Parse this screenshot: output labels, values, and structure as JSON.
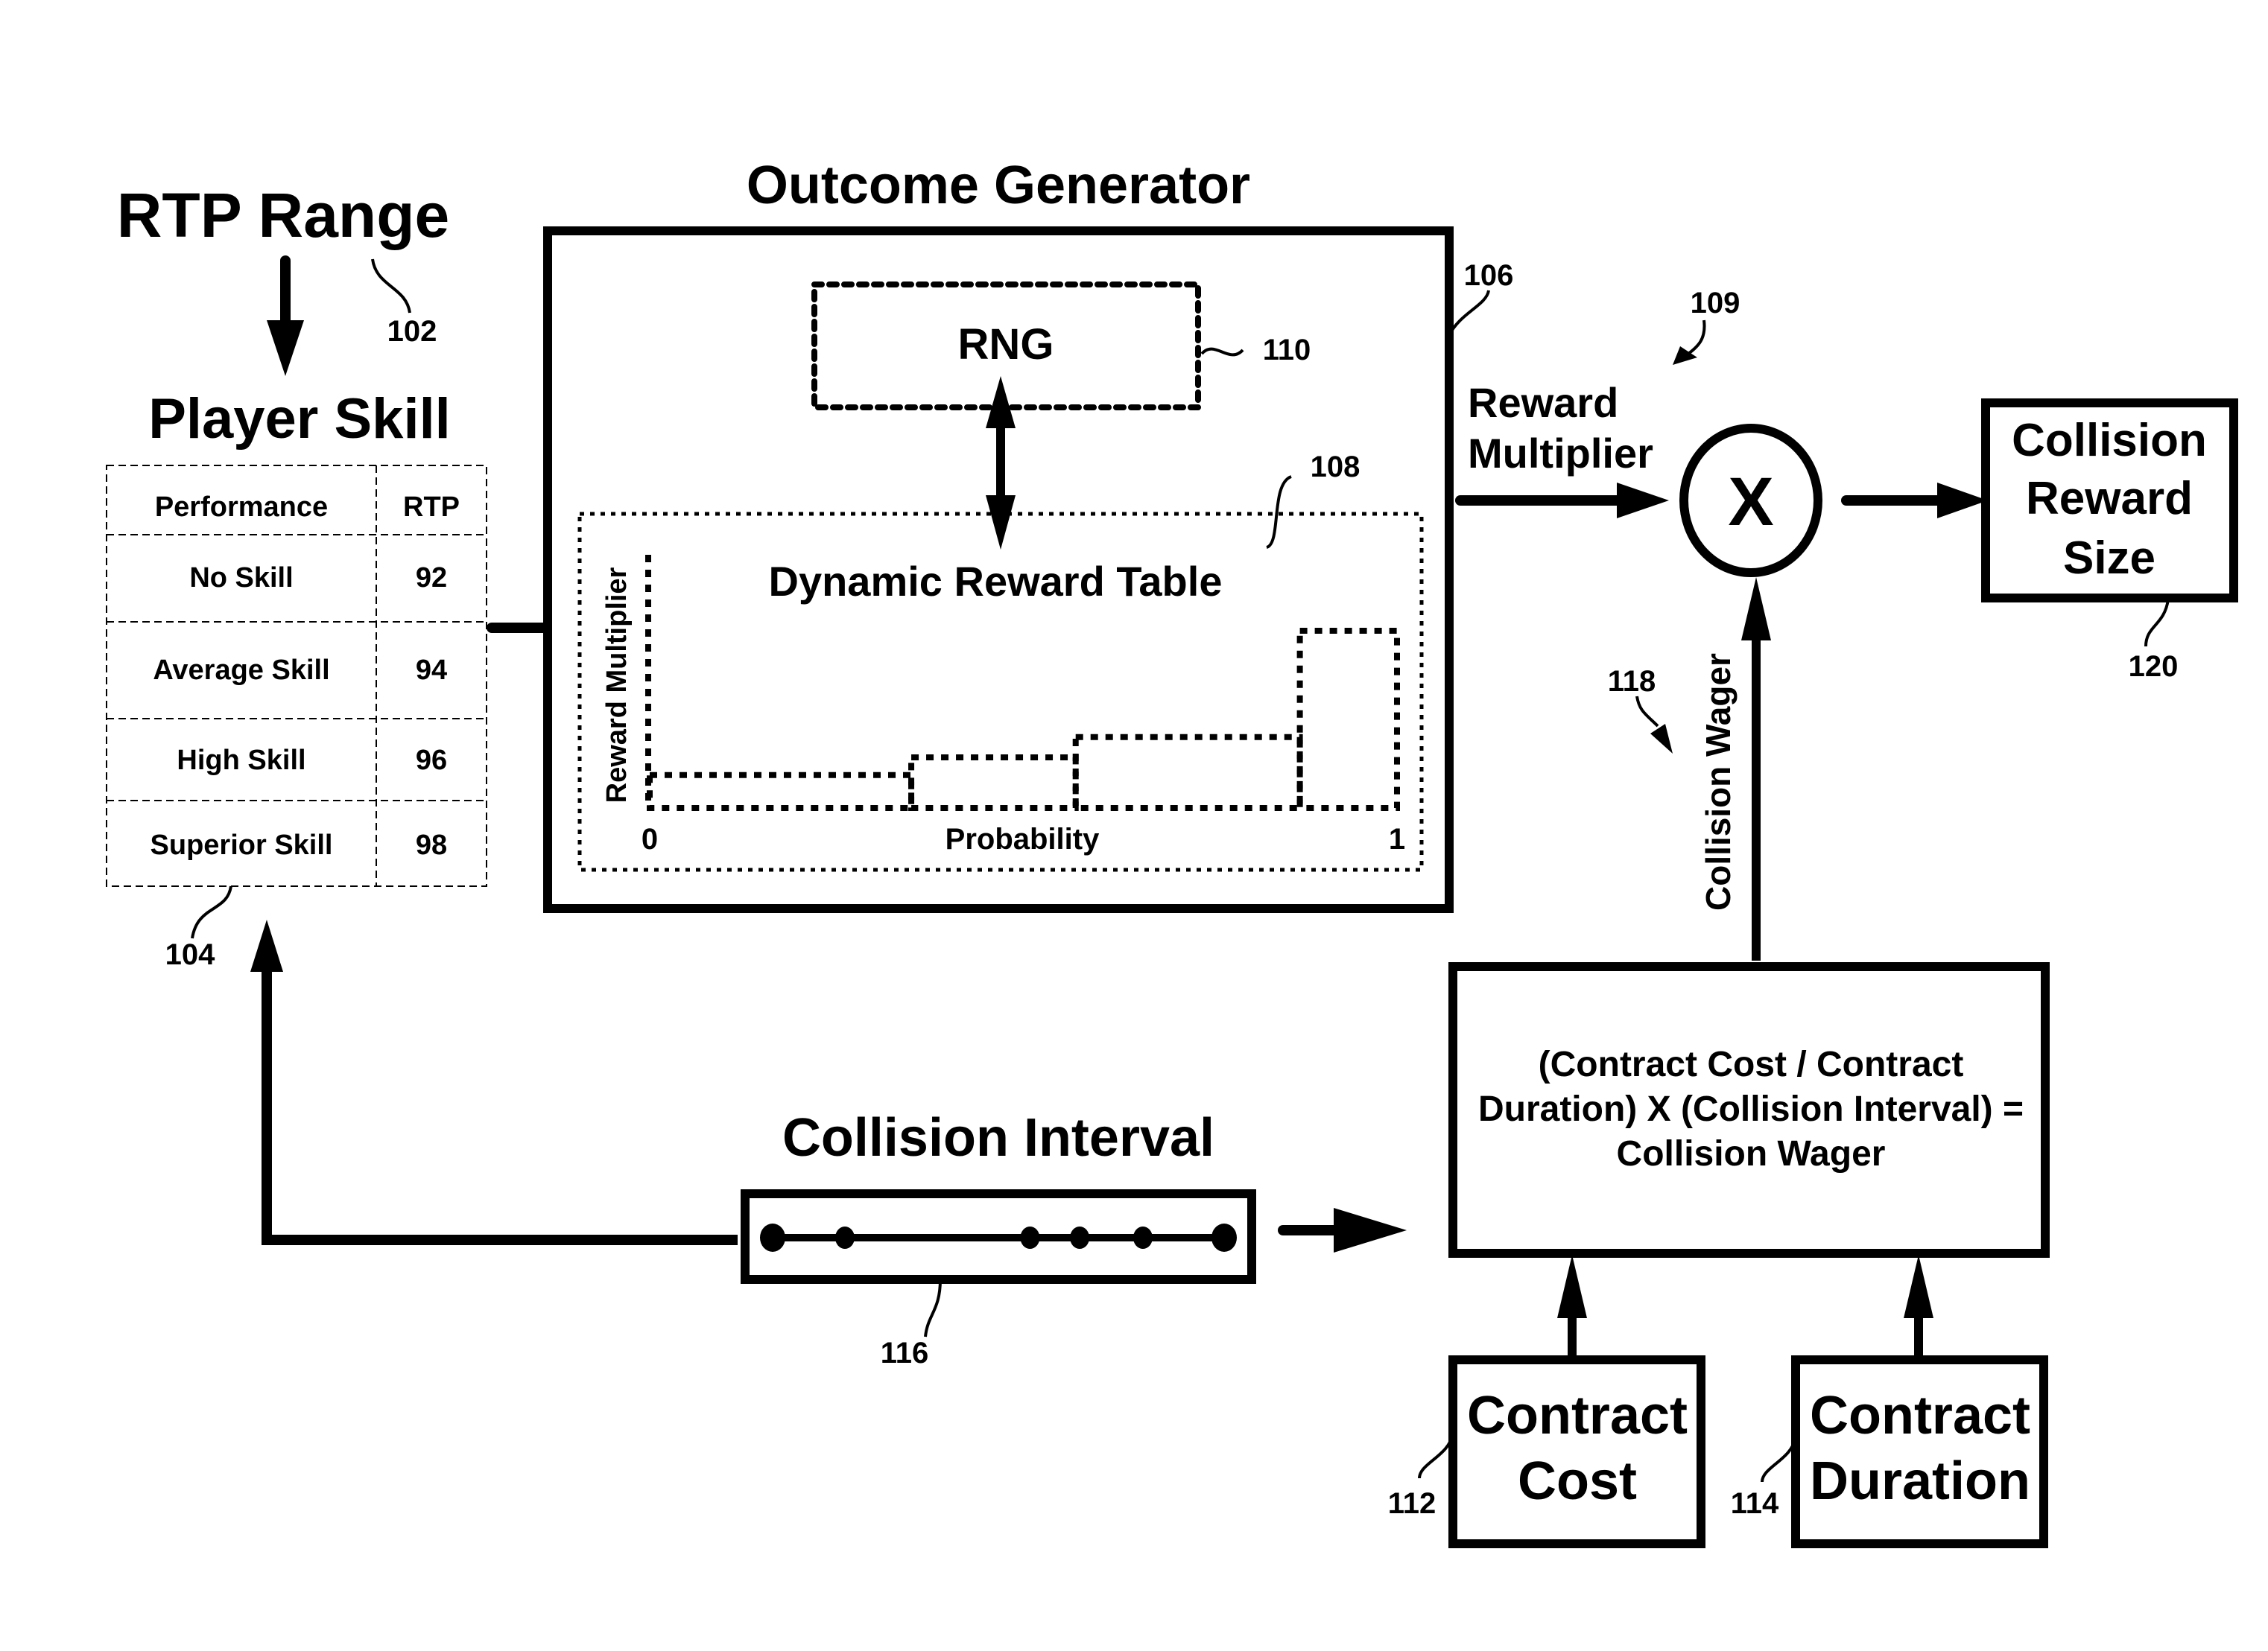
{
  "rtp_range": {
    "title": "RTP Range",
    "ref": "102"
  },
  "player_skill": {
    "title": "Player Skill",
    "ref": "104",
    "table": {
      "headers": [
        "Performance",
        "RTP"
      ],
      "rows": [
        {
          "performance": "No Skill",
          "rtp": "92"
        },
        {
          "performance": "Average Skill",
          "rtp": "94"
        },
        {
          "performance": "High Skill",
          "rtp": "96"
        },
        {
          "performance": "Superior Skill",
          "rtp": "98"
        }
      ]
    }
  },
  "outcome_generator": {
    "title": "Outcome Generator",
    "ref": "106",
    "rng": {
      "label": "RNG",
      "ref": "110"
    },
    "dynamic_reward_table": {
      "title": "Dynamic Reward Table",
      "ref": "108",
      "ylabel": "Reward Multiplier",
      "xlabel": "Probability",
      "x_min_label": "0",
      "x_max_label": "1"
    }
  },
  "chart_data": {
    "type": "bar",
    "title": "Dynamic Reward Table",
    "xlabel": "Probability",
    "ylabel": "Reward Multiplier",
    "xlim": [
      0,
      1
    ],
    "x_tick_labels": [
      "0",
      "1"
    ],
    "ylim": [
      0,
      1
    ],
    "bars": [
      {
        "x_start": 0.0,
        "x_end": 0.35,
        "relative_height": 0.13
      },
      {
        "x_start": 0.35,
        "x_end": 0.57,
        "relative_height": 0.2
      },
      {
        "x_start": 0.57,
        "x_end": 0.87,
        "relative_height": 0.28
      },
      {
        "x_start": 0.87,
        "x_end": 1.0,
        "relative_height": 0.7
      }
    ],
    "grid": false,
    "note": "Schematic step distribution; no numeric y-axis values shown"
  },
  "multiplier": {
    "symbol": "X",
    "ref": "109",
    "input_label_line1": "Reward",
    "input_label_line2": "Multiplier"
  },
  "collision_reward_size": {
    "lines": [
      "Collision",
      "Reward",
      "Size"
    ],
    "ref": "120"
  },
  "collision_wager": {
    "label": "Collision Wager",
    "ref": "118"
  },
  "formula": {
    "lines": [
      "(Contract Cost / Contract",
      "Duration) X (Collision Interval) =",
      "Collision Wager"
    ]
  },
  "contract_cost": {
    "lines": [
      "Contract",
      "Cost"
    ],
    "ref": "112"
  },
  "contract_duration": {
    "lines": [
      "Contract",
      "Duration"
    ],
    "ref": "114"
  },
  "collision_interval": {
    "title": "Collision Interval",
    "ref": "116",
    "event_positions": [
      0.0,
      0.16,
      0.57,
      0.68,
      0.82,
      1.0
    ]
  }
}
